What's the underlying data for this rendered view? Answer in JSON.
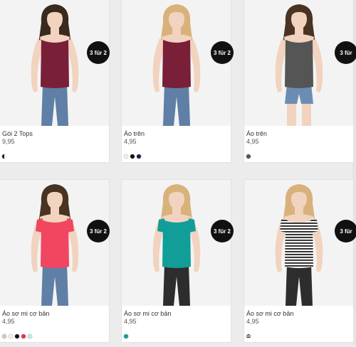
{
  "products": [
    {
      "name": "Gói 2 Tops",
      "price": "9,95",
      "badge": "3 für 2",
      "model": {
        "hair": "#3a2a1e",
        "skin": "#f1d3bf",
        "top": "#7a1f38",
        "bottom": "#5f7fa6",
        "bottom_type": "jeans"
      },
      "swatches": [
        "#111111"
      ]
    },
    {
      "name": "Áo trên",
      "price": "4,95",
      "badge": "3 für 2",
      "model": {
        "hair": "#d8b27a",
        "skin": "#f1d3bf",
        "top": "#7a1f38",
        "bottom": "#5f7fa6",
        "bottom_type": "jeans"
      },
      "swatches": [
        "#eeeeee",
        "#111111",
        "#1c1e57"
      ]
    },
    {
      "name": "Áo trên",
      "price": "4,95",
      "badge": "3 für",
      "model": {
        "hair": "#4a3323",
        "skin": "#f1d3bf",
        "top": "#555555",
        "bottom": "#6c8db3",
        "bottom_type": "shorts"
      },
      "swatches": [
        "#555555"
      ]
    },
    {
      "name": "Áo sơ mi cơ bản",
      "price": "4,95",
      "badge": "3 für 2",
      "model": {
        "hair": "#4a3323",
        "skin": "#f1d3bf",
        "top": "#f2455f",
        "bottom": "#5f7fa6",
        "bottom_type": "jeans"
      },
      "swatches": [
        "#d8c8b8",
        "#eeeeee",
        "#111111",
        "#e8334a",
        "#bfe6ee"
      ]
    },
    {
      "name": "Áo sơ mi cơ bản",
      "price": "4,95",
      "badge": "3 für 2",
      "model": {
        "hair": "#d8b27a",
        "skin": "#f1d3bf",
        "top": "#119e99",
        "bottom": "#2d2d2d",
        "bottom_type": "jeans"
      },
      "swatches": [
        "#119e99"
      ]
    },
    {
      "name": "Áo sơ mi cơ bản",
      "price": "4,95",
      "badge": "3 für",
      "model": {
        "hair": "#d8b27a",
        "skin": "#f1d3bf",
        "top": "stripes",
        "bottom": "#2d2d2d",
        "bottom_type": "jeans"
      },
      "swatches": [
        "stripes"
      ]
    }
  ]
}
